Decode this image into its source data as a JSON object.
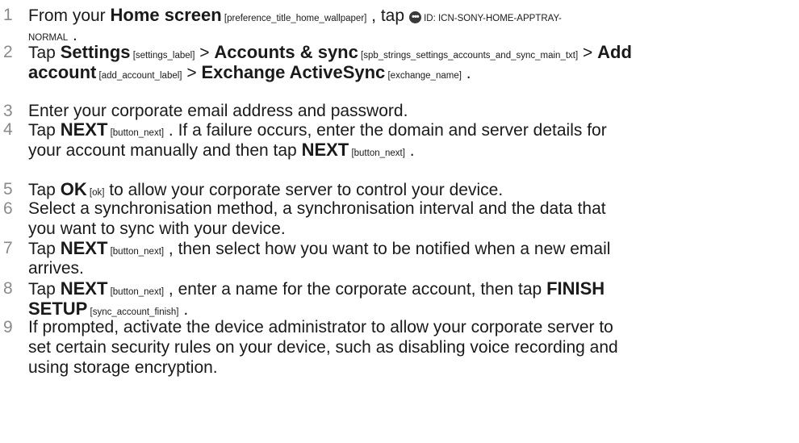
{
  "steps": [
    {
      "number": "1",
      "line1": {
        "t1": "From your ",
        "b1": "Home screen",
        "k1": " [preference_title_home_wallpaper]",
        "t2": " , tap ",
        "icon_glyph": "•••",
        "icon_name": "apptray-icon",
        "icon_id": " ID: ICN-SONY-HOME-APPTRAY-"
      },
      "line2": {
        "k1": "NORMAL",
        "t1": " ."
      }
    },
    {
      "number": "2",
      "line1": {
        "t1": "Tap ",
        "b1": "Settings",
        "k1": " [settings_label]",
        "t2": " > ",
        "b2": "Accounts & sync",
        "k2": " [spb_strings_settings_accounts_and_sync_main_txt]",
        "t3": " > ",
        "b3": "Add"
      },
      "line2": {
        "b1": "account",
        "k1": " [add_account_label]",
        "t1": " > ",
        "b2": "Exchange ActiveSync",
        "k2": " [exchange_name]",
        "t2": " ."
      }
    },
    {
      "number": "3",
      "line1": {
        "t1": "Enter your corporate email address and password."
      }
    },
    {
      "number": "4",
      "line1": {
        "t1": "Tap ",
        "b1": "NEXT",
        "k1": " [button_next]",
        "t2": " . If a failure occurs, enter the domain and server details for"
      },
      "line2": {
        "t1": "your account manually and then tap ",
        "b1": "NEXT",
        "k1": " [button_next]",
        "t2": " ."
      }
    },
    {
      "number": "5",
      "line1": {
        "t1": "Tap ",
        "b1": "OK",
        "k1": " [ok]",
        "t2": " to allow your corporate server to control your device."
      }
    },
    {
      "number": "6",
      "line1": {
        "t1": "Select a synchronisation method, a synchronisation interval and the data that"
      },
      "line2": {
        "t1": "you want to sync with your device."
      }
    },
    {
      "number": "7",
      "line1": {
        "t1": "Tap ",
        "b1": "NEXT",
        "k1": " [button_next]",
        "t2": " , then select how you want to be notified when a new email"
      },
      "line2": {
        "t1": "arrives."
      }
    },
    {
      "number": "8",
      "line1": {
        "t1": "Tap ",
        "b1": "NEXT",
        "k1": " [button_next]",
        "t2": " , enter a name for the corporate account, then tap ",
        "b2": "FINISH"
      },
      "line2": {
        "b1": "SETUP",
        "k1": " [sync_account_finish]",
        "t1": " ."
      }
    },
    {
      "number": "9",
      "line1": {
        "t1": "If prompted, activate the device administrator to allow your corporate server to"
      },
      "line2": {
        "t1": "set certain security rules on your device, such as disabling voice recording and"
      },
      "line3": {
        "t1": "using storage encryption."
      }
    }
  ]
}
